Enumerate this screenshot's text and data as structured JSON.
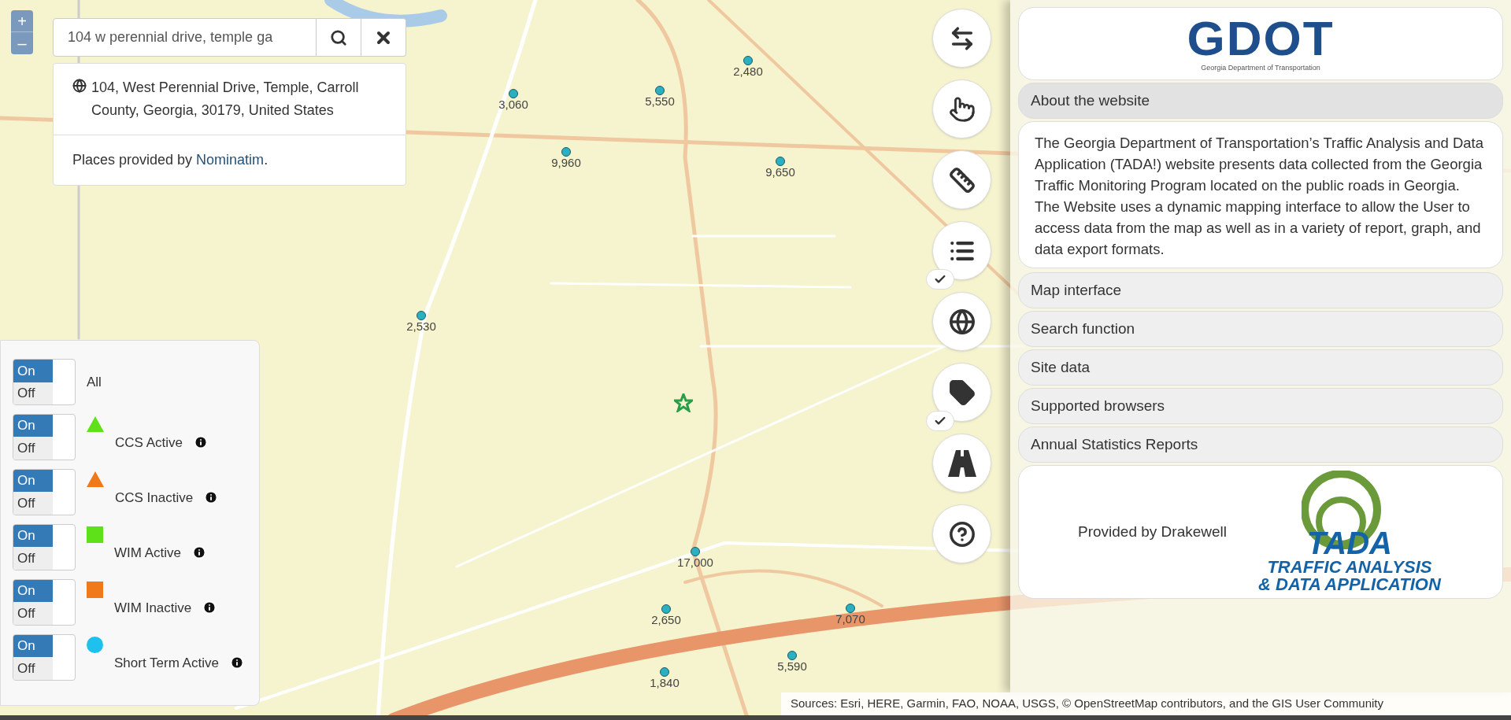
{
  "zoom_control": {
    "zoom_in": "+",
    "zoom_out": "–"
  },
  "search": {
    "value": "104 w perennial drive, temple ga",
    "result": "104, West Perennial Drive, Temple, Carroll County, Georgia, 30179, United States",
    "credit_prefix": "Places provided by ",
    "credit_link": "Nominatim",
    "credit_suffix": "."
  },
  "legend": {
    "all": {
      "label": "All",
      "on": true,
      "on_label": "On",
      "off_label": "Off"
    },
    "layers": [
      {
        "label": "CCS Active",
        "on": true,
        "on_label": "On",
        "off_label": "Off",
        "kind": "triangle",
        "color": "#5fe11a"
      },
      {
        "label": "CCS Inactive",
        "on": true,
        "on_label": "On",
        "off_label": "Off",
        "kind": "triangle",
        "color": "#f07a1a"
      },
      {
        "label": "WIM Active",
        "on": true,
        "on_label": "On",
        "off_label": "Off",
        "kind": "square",
        "color": "#5fe11a"
      },
      {
        "label": "WIM Inactive",
        "on": true,
        "on_label": "On",
        "off_label": "Off",
        "kind": "square",
        "color": "#f07a1a"
      },
      {
        "label": "Short Term Active",
        "on": true,
        "on_label": "On",
        "off_label": "Off",
        "kind": "circle",
        "color": "#1ec0ee"
      }
    ]
  },
  "map_markers": [
    {
      "count": "2,480",
      "kind": "station"
    },
    {
      "count": "3,060",
      "kind": "station"
    },
    {
      "count": "5,550",
      "kind": "station"
    },
    {
      "count": "9,960",
      "kind": "station"
    },
    {
      "count": "9,650",
      "kind": "station"
    },
    {
      "count": "2,530",
      "kind": "station"
    },
    {
      "count": "17,000",
      "kind": "station"
    },
    {
      "count": "2,650",
      "kind": "station"
    },
    {
      "count": "7,070",
      "kind": "station"
    },
    {
      "count": "5,590",
      "kind": "station"
    },
    {
      "count": "1,840",
      "kind": "station"
    },
    {
      "kind": "location"
    }
  ],
  "tools": [
    {
      "kind": "pan",
      "checked": false
    },
    {
      "kind": "select",
      "checked": false
    },
    {
      "kind": "measure",
      "checked": false
    },
    {
      "kind": "list",
      "checked": true
    },
    {
      "kind": "basemap",
      "checked": false
    },
    {
      "kind": "labels",
      "checked": true
    },
    {
      "kind": "roads",
      "checked": false
    },
    {
      "kind": "help",
      "checked": false
    }
  ],
  "side_panel": {
    "logo": {
      "name": "GDOT",
      "subtitle": "Georgia Department of Transportation"
    },
    "sections": [
      {
        "title": "About the website",
        "expanded": true,
        "body": "The Georgia Department of Transportation’s Traffic Analysis and Data Application (TADA!) website presents data collected from the Georgia Traffic Monitoring Program located on the public roads in Georgia. The Website uses a dynamic mapping interface to allow the User to access data from the map as well as in a variety of report, graph, and data export formats."
      },
      {
        "title": "Map interface",
        "expanded": false
      },
      {
        "title": "Search function",
        "expanded": false
      },
      {
        "title": "Site data",
        "expanded": false
      },
      {
        "title": "Supported browsers",
        "expanded": false
      },
      {
        "title": "Annual Statistics Reports",
        "expanded": false
      }
    ],
    "footer": {
      "provider": "Provided by Drakewell",
      "logo_name": "TADA",
      "logo_line_1": "TRAFFIC ANALYSIS",
      "logo_line_2": "& DATA APPLICATION"
    }
  },
  "attribution": "Sources: Esri, HERE, Garmin, FAO, NOAA, USGS, © OpenStreetMap contributors, and the GIS User Community"
}
